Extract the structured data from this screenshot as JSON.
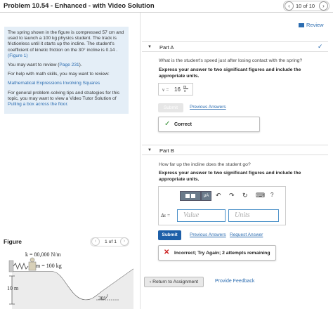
{
  "header": {
    "title": "Problem 10.54 - Enhanced - with Video Solution",
    "pager": "10 of 10",
    "prev_glyph": "‹",
    "next_glyph": "›"
  },
  "review_label": "Review",
  "problem": {
    "statement": "The spring shown in the figure is compressed 57 cm and used to launch a 100 kg physics student. The track is frictionless until it starts up the incline. The student's coefficient of kinetic friction on the 30° incline is 0.14 .",
    "figure_ref": "(Figure 1)",
    "review_prefix": "You may want to review (",
    "review_page": "Page 231",
    "review_suffix": ").",
    "math_help": "For help with math skills, you may want to review:",
    "math_link": "Mathematical Expressions Involving Squares",
    "strategy_text": "For general problem-solving tips and strategies for this topic, you may want to view a Video Tutor Solution of",
    "strategy_link": "Pulling a box across the floor."
  },
  "part_a": {
    "label": "Part A",
    "question": "What is the student's speed just after losing contact with the spring?",
    "instruction": "Express your answer to two significant figures and include the appropriate units.",
    "answer_var": "v =",
    "answer_value": "16",
    "answer_unit_num": "m",
    "answer_unit_den": "s",
    "submit_label": "Submit",
    "previous_answers": "Previous Answers",
    "feedback": "Correct"
  },
  "part_b": {
    "label": "Part B",
    "question": "How far up the incline does the student go?",
    "instruction": "Express your answer to two significant figures and include the appropriate units.",
    "answer_var": "Δs =",
    "value_placeholder": "Value",
    "units_placeholder": "Units",
    "submit_label": "Submit",
    "previous_answers": "Previous Answers",
    "request_answer": "Request Answer",
    "feedback": "Incorrect; Try Again; 2 attempts remaining",
    "toolbar": [
      "μA",
      "↶",
      "↷",
      "↻",
      "⌨",
      "?"
    ]
  },
  "footer": {
    "return_label": "‹ Return to Assignment",
    "provide_feedback": "Provide Feedback"
  },
  "figure": {
    "title": "Figure",
    "pager": "1 of 1",
    "k_label": "k = 80,000 N/m",
    "m_label": "m = 100 kg",
    "height_label": "10 m",
    "angle_label": "30°"
  },
  "colors": {
    "accent": "#2b6cb0",
    "submit": "#1d5fa8",
    "correct": "#2e8b2e",
    "incorrect": "#cc2222",
    "problem_bg": "#e4eef7"
  }
}
